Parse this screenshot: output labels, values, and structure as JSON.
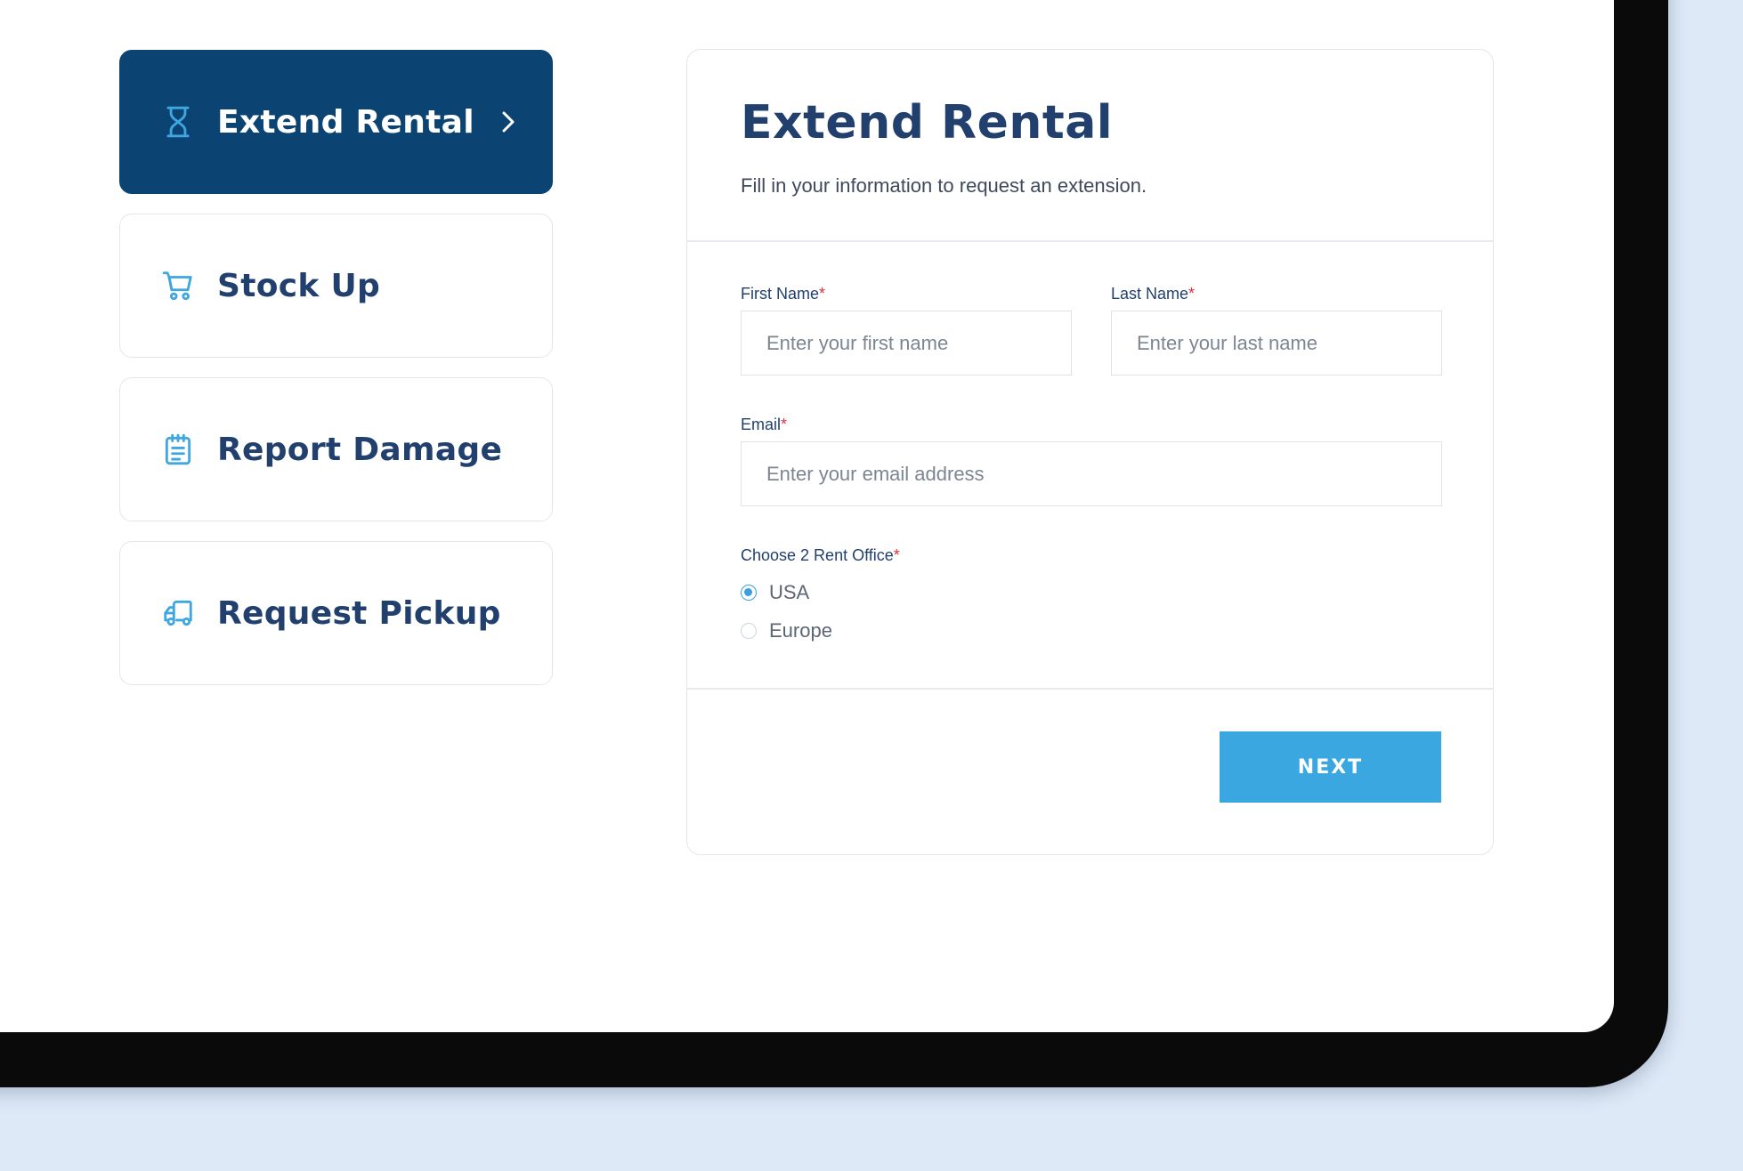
{
  "menu": {
    "items": [
      {
        "label": "Extend Rental",
        "icon": "hourglass-icon",
        "active": true
      },
      {
        "label": "Stock Up",
        "icon": "cart-icon",
        "active": false
      },
      {
        "label": "Report Damage",
        "icon": "clipboard-icon",
        "active": false
      },
      {
        "label": "Request Pickup",
        "icon": "truck-icon",
        "active": false
      }
    ]
  },
  "form": {
    "title": "Extend Rental",
    "subtitle": "Fill in your information to request an extension.",
    "first_name": {
      "label": "First Name",
      "required_mark": "*",
      "placeholder": "Enter your first name",
      "value": ""
    },
    "last_name": {
      "label": "Last Name",
      "required_mark": "*",
      "placeholder": "Enter your last name",
      "value": ""
    },
    "email": {
      "label": "Email",
      "required_mark": "*",
      "placeholder": "Enter your email address",
      "value": ""
    },
    "office": {
      "label": "Choose 2 Rent Office",
      "required_mark": "*",
      "options": [
        {
          "label": "USA",
          "selected": true
        },
        {
          "label": "Europe",
          "selected": false
        }
      ]
    },
    "next_label": "NEXT"
  },
  "colors": {
    "primary_dark": "#0b4472",
    "accent": "#3aa7e0",
    "heading": "#22406e",
    "required": "#e0323c",
    "background": "#dde9f7"
  }
}
